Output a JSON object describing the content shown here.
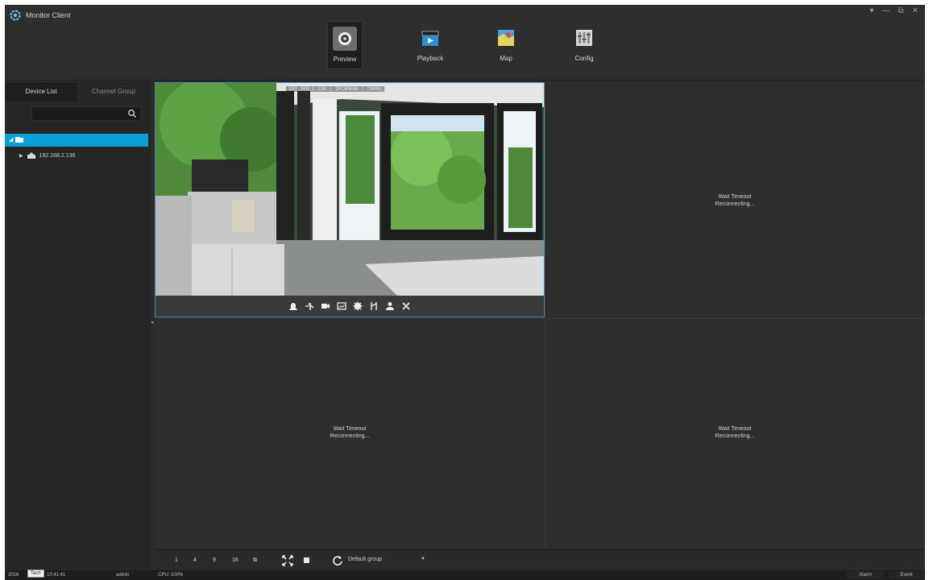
{
  "app": {
    "title": "Monitor Client"
  },
  "window_controls": [
    "▾",
    "—",
    "⧉",
    "✕"
  ],
  "nav": [
    {
      "label": "Preview",
      "icon": "preview-camera-icon",
      "active": true
    },
    {
      "label": "Playback",
      "icon": "playback-clapper-icon",
      "active": false
    },
    {
      "label": "Map",
      "icon": "map-icon",
      "active": false
    },
    {
      "label": "Config",
      "icon": "config-icon",
      "active": false
    }
  ],
  "sidebar": {
    "tabs": [
      {
        "label": "Device List",
        "active": true
      },
      {
        "label": "Channel Group",
        "active": false
      }
    ],
    "search": {
      "value": "",
      "placeholder": ""
    },
    "tree": {
      "root_label": "",
      "devices": [
        {
          "label": "192.168.2.136"
        }
      ]
    }
  },
  "grid": {
    "cells": [
      {
        "osd": "192.168.2.136 | IPCAMERA | CH001",
        "status": "live"
      },
      {
        "line1": "Wait Timeout",
        "line2": "Reconnecting..."
      },
      {
        "line1": "Wait Timeout",
        "line2": "Reconnecting..."
      },
      {
        "line1": "Wait Timeout",
        "line2": "Reconnecting..."
      }
    ],
    "toolbar_icons": [
      "alarm-icon",
      "ptz-icon",
      "record-icon",
      "snapshot-icon",
      "settings-icon",
      "audio-icon",
      "talk-icon",
      "close-icon"
    ]
  },
  "bottom_bar": {
    "layouts": [
      "1",
      "4",
      "9",
      "16",
      "⧉"
    ],
    "group": "Default group"
  },
  "status": {
    "date": "2016",
    "tip": "Tech",
    "time": "10:41:41",
    "user": "admin",
    "cpu": "CPU: 100%",
    "alarm": "Alarm",
    "event": "Event"
  },
  "colors": {
    "accent": "#0a9fd8",
    "background": "#2b2b2b",
    "panel": "#262626"
  }
}
